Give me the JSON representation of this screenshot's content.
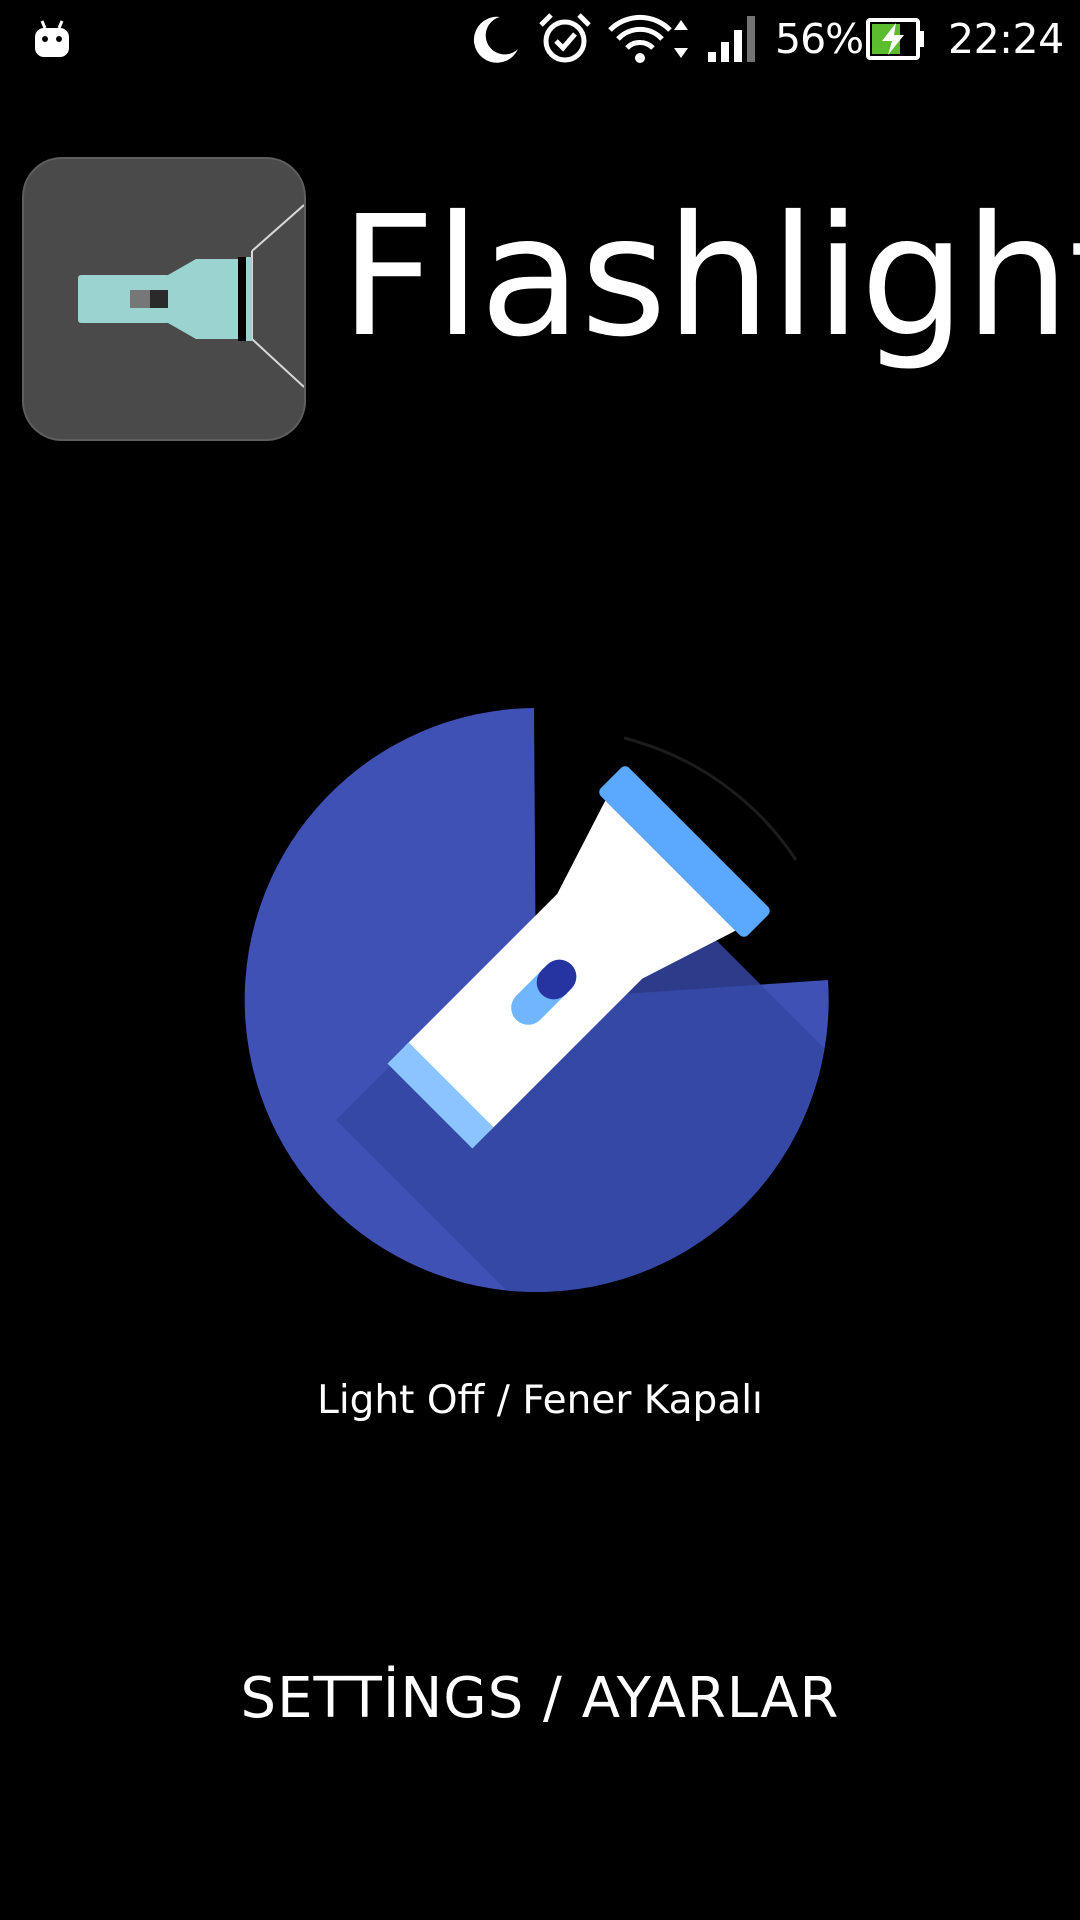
{
  "status_bar": {
    "battery_percent": "56%",
    "time": "22:24",
    "icons": [
      "android-notification-icon",
      "moon-icon",
      "alarm-icon",
      "wifi-icon",
      "signal-icon",
      "battery-charging-icon"
    ]
  },
  "header": {
    "title": "Flashlight",
    "logo_icon": "flashlight-logo-icon"
  },
  "main": {
    "toggle_icon": "flashlight-icon",
    "status_text": "Light Off / Fener Kapalı",
    "settings_label": "SETTİNGS / AYARLAR"
  },
  "colors": {
    "background": "#000000",
    "accent_blue": "#3f51b5",
    "logo_bg": "#4a4a4a",
    "logo_flashlight": "#9ad3cf",
    "flashlight_head": "#5aa8ff"
  }
}
